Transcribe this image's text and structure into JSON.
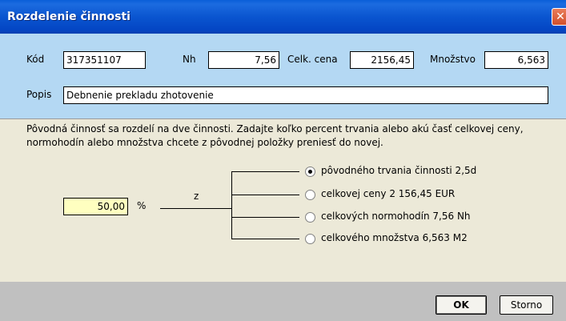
{
  "window": {
    "title": "Rozdelenie činnosti",
    "close_glyph": "✕"
  },
  "fields": {
    "kod": {
      "label": "Kód",
      "value": "317351107"
    },
    "nh": {
      "label": "Nh",
      "value": "7,56"
    },
    "celk_cena": {
      "label": "Celk. cena",
      "value": "2156,45"
    },
    "mnozstvo": {
      "label": "Množstvo",
      "value": "6,563"
    },
    "popis": {
      "label": "Popis",
      "value": "Debnenie prekladu zhotovenie"
    }
  },
  "description": {
    "line1": "Pôvodná činnosť sa rozdelí na dve činnosti. Zadajte koľko percent trvania alebo akú časť celkovej ceny,",
    "line2": "normohodín alebo množstva chcete z pôvodnej položky preniesť do novej."
  },
  "split": {
    "percent_value": "50,00",
    "percent_unit": "%",
    "z_label": "z",
    "options": [
      {
        "label": "pôvodného trvania činnosti 2,5d",
        "selected": true
      },
      {
        "label": "celkovej ceny 2 156,45 EUR",
        "selected": false
      },
      {
        "label": "celkových normohodín 7,56 Nh",
        "selected": false
      },
      {
        "label": "celkového množstva 6,563 M2",
        "selected": false
      }
    ]
  },
  "buttons": {
    "ok": "OK",
    "storno": "Storno"
  },
  "colors": {
    "titlebar": "#0a55d0",
    "top_panel": "#b4d8f3",
    "body": "#ece9d8",
    "percent_field": "#ffffc0"
  }
}
